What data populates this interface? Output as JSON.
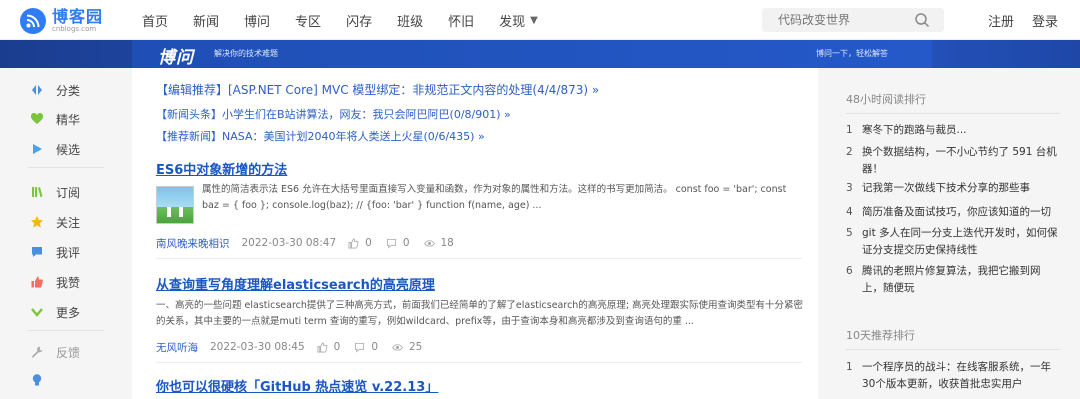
{
  "nav": {
    "logo_title": "博客园",
    "logo_sub": "cnblogs.com",
    "items": [
      "首页",
      "新闻",
      "博问",
      "专区",
      "闪存",
      "班级",
      "怀旧",
      "发现"
    ],
    "search_placeholder": "代码改变世界",
    "register": "注册",
    "login": "登录"
  },
  "banner": {
    "logo": "博问",
    "slogan": "解决你的技术难题",
    "right": "博问一下，轻松解答"
  },
  "left_menu": {
    "group1": [
      "分类",
      "精华",
      "候选"
    ],
    "group2": [
      "订阅",
      "关注",
      "我评",
      "我赞",
      "更多"
    ],
    "group3": [
      "反馈"
    ]
  },
  "headlines": [
    "【编辑推荐】[ASP.NET Core] MVC 模型绑定：非规范正文内容的处理(4/4/873) »",
    "【新闻头条】小学生们在B站讲算法，网友：我只会阿巴阿巴(0/8/901) »",
    "【推荐新闻】NASA：美国计划2040年将人类送上火星(0/6/435) »"
  ],
  "posts": [
    {
      "title": "ES6中对象新增的方法",
      "summary": "属性的简洁表示法 ES6 允许在大括号里面直接写入变量和函数，作为对象的属性和方法。这样的书写更加简洁。 const foo = 'bar'; const baz = { foo }; console.log(baz); // {foo: 'bar' } function f(name, age) ...",
      "author": "南风晚来晚相识",
      "date": "2022-03-30 08:47",
      "likes": "0",
      "comments": "0",
      "views": "18"
    },
    {
      "title": "从查询重写角度理解elasticsearch的高亮原理",
      "summary": "一、高亮的一些问题 elasticsearch提供了三种高亮方式，前面我们已经简单的了解了elasticsearch的高亮原理; 高亮处理跟实际使用查询类型有十分紧密的关系，其中主要的一点就是muti term 查询的重写，例如wildcard、prefix等，由于查询本身和高亮都涉及到查询语句的重 ...",
      "author": "无风听海",
      "date": "2022-03-30 08:45",
      "likes": "0",
      "comments": "0",
      "views": "25"
    },
    {
      "title": "你也可以很硬核「GitHub 热点速览 v.22.13」"
    }
  ],
  "right": {
    "hot48_heading": "48小时阅读排行",
    "hot48": [
      {
        "num": "1",
        "text": "寒冬下的跑路与裁员..."
      },
      {
        "num": "2",
        "text": "换个数据结构，一不小心节约了 591 台机器！"
      },
      {
        "num": "3",
        "text": "记我第一次做线下技术分享的那些事"
      },
      {
        "num": "4",
        "text": "简历准备及面试技巧，你应该知道的一切"
      },
      {
        "num": "5",
        "text": "git 多人在同一分支上迭代开发时，如何保证分支提交历史保持线性"
      },
      {
        "num": "6",
        "text": "腾讯的老照片修复算法，我把它搬到网上，随便玩"
      }
    ],
    "hot10_heading": "10天推荐排行",
    "hot10": [
      {
        "num": "1",
        "text": "一个程序员的战斗：在线客服系统，一年30个版本更新，收获首批忠实用户"
      }
    ]
  },
  "colors": {
    "brand": "#2e7cf6",
    "link": "#2c5fc7",
    "banner": "#2150b8"
  }
}
